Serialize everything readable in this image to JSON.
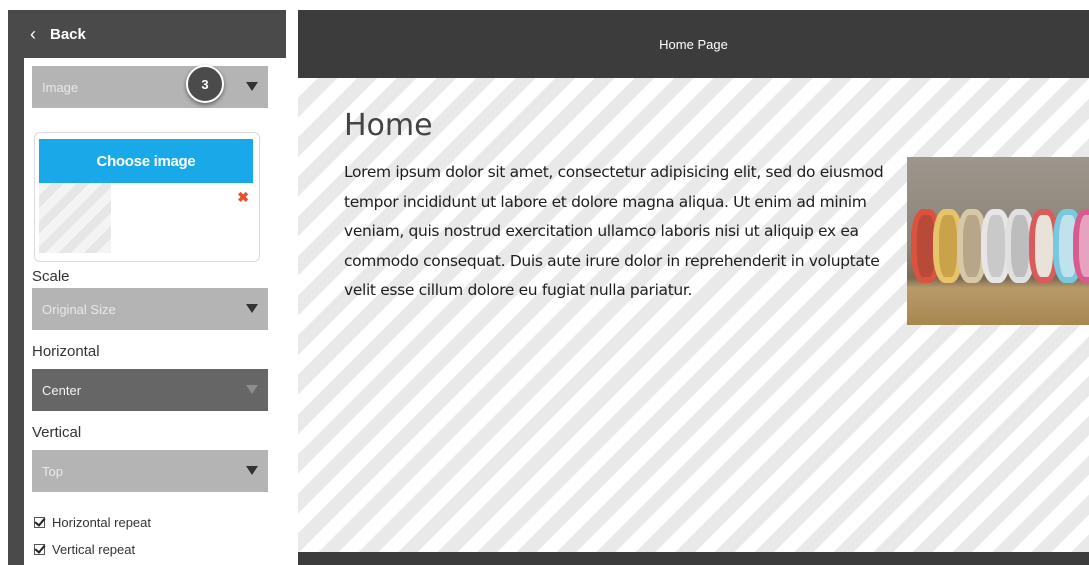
{
  "sidebar": {
    "back_label": "Back",
    "image_select": {
      "value": "Image",
      "badge": "3"
    },
    "choose_image_label": "Choose image",
    "remove_symbol": "✖",
    "scale": {
      "label": "Scale",
      "value": "Original Size"
    },
    "horizontal": {
      "label": "Horizontal",
      "value": "Center"
    },
    "vertical": {
      "label": "Vertical",
      "value": "Top"
    },
    "checkboxes": [
      {
        "label": "Horizontal repeat",
        "checked": true
      },
      {
        "label": "Vertical repeat",
        "checked": true
      }
    ]
  },
  "preview": {
    "header_title": "Home Page",
    "page_heading": "Home",
    "body_text": "Lorem ipsum dolor sit amet, consectetur adipisicing elit, sed do eiusmod tempor incididunt ut labore et dolore magna aliqua. Ut enim ad minim veniam, quis nostrud exercitation ullamco laboris nisi ut aliquip ex ea commodo consequat. Duis aute irure dolor in reprehenderit in voluptate velit esse cillum dolore eu fugiat nulla pariatur."
  },
  "colors": {
    "accent": "#1aa9e8",
    "sidebar_bg": "#4a4a4a",
    "preview_bg": "#3c3c3c",
    "remove_icon": "#e8502b"
  }
}
